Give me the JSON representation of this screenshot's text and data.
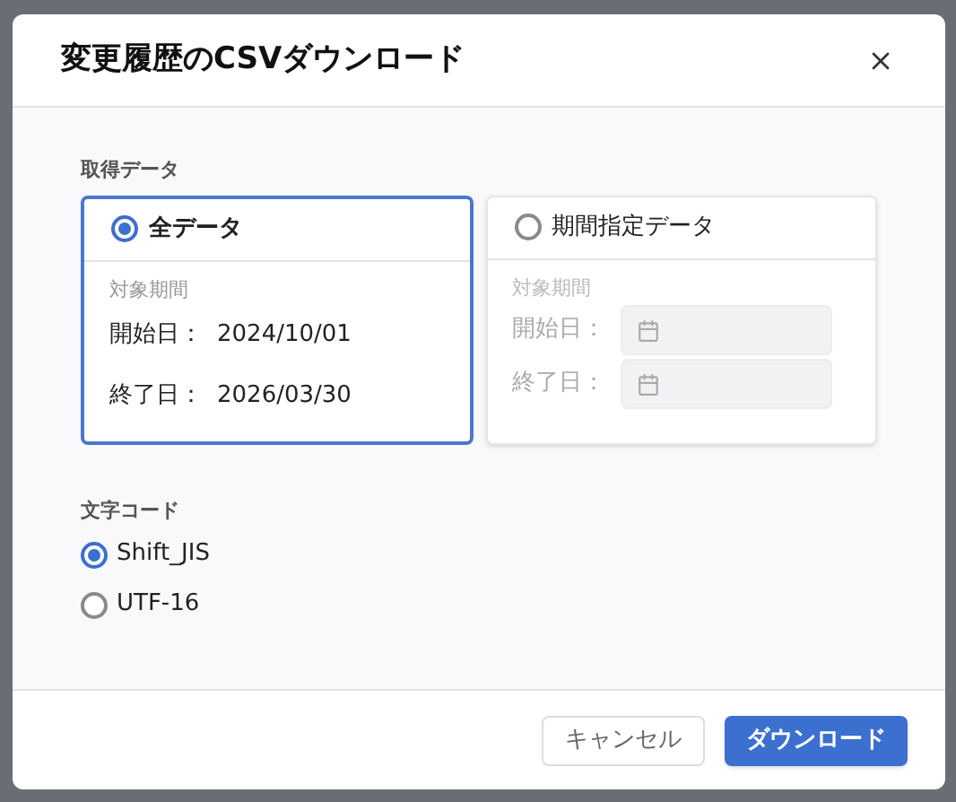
{
  "dialog": {
    "title": "変更履歴のCSVダウンロード"
  },
  "data_range": {
    "label": "取得データ",
    "options": [
      {
        "label": "全データ",
        "selected": true,
        "period_label": "対象期間",
        "start_label": "開始日：",
        "start_value": "2024/10/01",
        "end_label": "終了日：",
        "end_value": "2026/03/30"
      },
      {
        "label": "期間指定データ",
        "selected": false,
        "period_label": "対象期間",
        "start_label": "開始日：",
        "end_label": "終了日："
      }
    ]
  },
  "encoding": {
    "label": "文字コード",
    "options": [
      {
        "label": "Shift_JIS",
        "selected": true
      },
      {
        "label": "UTF-16",
        "selected": false
      }
    ]
  },
  "buttons": [
    {
      "label": "キャンセル",
      "kind": "secondary"
    },
    {
      "label": "ダウンロード",
      "kind": "primary"
    }
  ]
}
